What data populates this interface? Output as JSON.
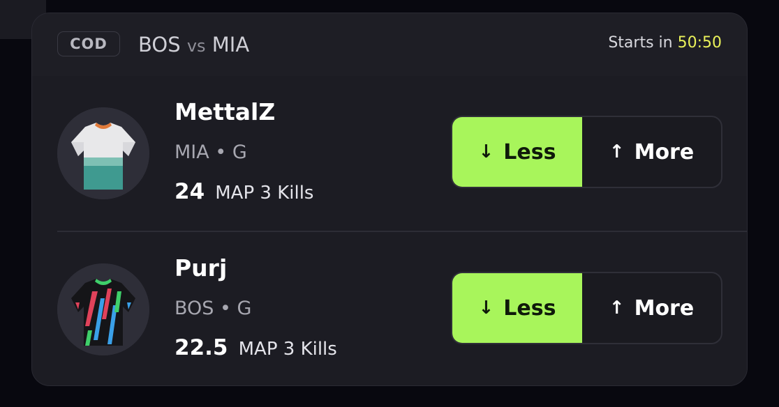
{
  "header": {
    "game_badge": "COD",
    "home_team": "BOS",
    "vs": "vs",
    "away_team": "MIA",
    "starts_label": "Starts in",
    "starts_time": "50:50"
  },
  "players": [
    {
      "name": "MettalZ",
      "meta": "MIA • G",
      "line_value": "24",
      "line_stat": "MAP 3 Kills",
      "jersey_icon": "jersey-white-teal-icon",
      "less_label": "Less",
      "more_label": "More",
      "selected": "less"
    },
    {
      "name": "Purj",
      "meta": "BOS • G",
      "line_value": "22.5",
      "line_stat": "MAP 3 Kills",
      "jersey_icon": "jersey-black-multicolor-icon",
      "less_label": "Less",
      "more_label": "More",
      "selected": "less"
    }
  ],
  "colors": {
    "accent": "#a8f55b",
    "timer": "#eaf25a",
    "background": "#08080f",
    "card": "#1c1c23"
  }
}
